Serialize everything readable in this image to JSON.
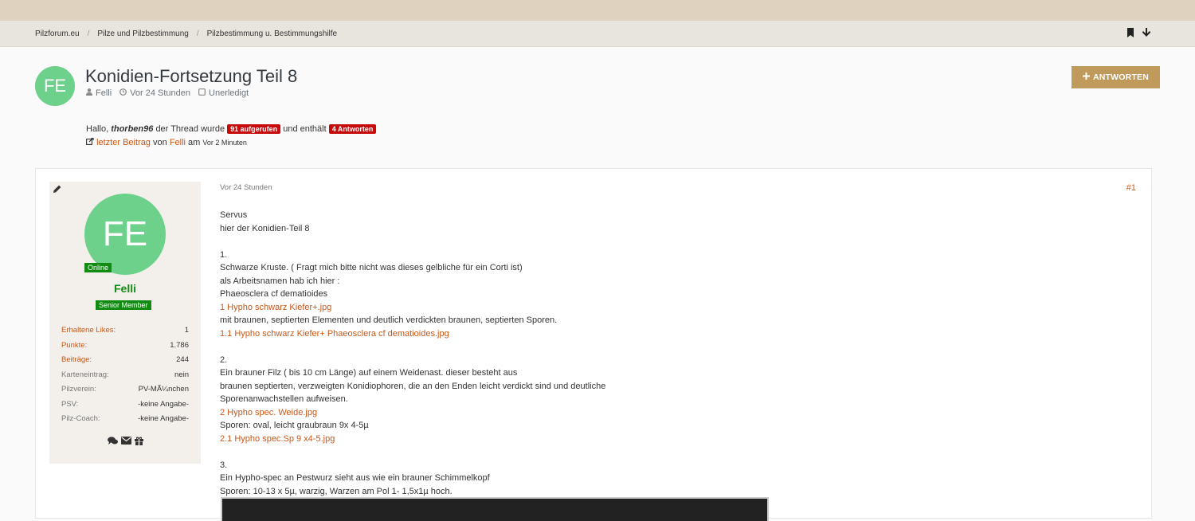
{
  "breadcrumb": [
    {
      "label": "Pilzforum.eu"
    },
    {
      "label": "Pilze und Pilzbestimmung"
    },
    {
      "label": "Pilzbestimmung u. Bestimmungshilfe"
    }
  ],
  "breadcrumb_icons": [
    "bookmark-icon",
    "arrow-down-icon"
  ],
  "thread": {
    "avatar_initials": "FE",
    "title": "Konidien-Fortsetzung Teil 8",
    "author": "Felli",
    "time": "Vor 24 Stunden",
    "status": "Unerledigt"
  },
  "reply_button": {
    "label": "ANTWORTEN"
  },
  "info": {
    "greeting": "Hallo,",
    "username": "thorben96",
    "text_mid": "der Thread wurde",
    "views_badge": "91 aufgerufen",
    "text_and": "und enthält",
    "replies_badge": "4 Antworten",
    "last_post_label": "letzter Beitrag",
    "by_text": "von",
    "last_author": "Felli",
    "at_text": "am",
    "last_time": "Vor 2 Minuten"
  },
  "sidebar": {
    "avatar_initials": "FE",
    "online_label": "Online",
    "username": "Felli",
    "rank": "Senior Member",
    "stats": [
      {
        "label": "Erhaltene Likes:",
        "value": "1",
        "link": true
      },
      {
        "label": "Punkte:",
        "value": "1.786",
        "link": true
      },
      {
        "label": "Beiträge:",
        "value": "244",
        "link": true
      },
      {
        "label": "Karteneintrag:",
        "value": "nein",
        "link": false
      },
      {
        "label": "Pilzverein:",
        "value": "PV-MÃ¼nchen",
        "link": false
      },
      {
        "label": "PSV:",
        "value": "-keine Angabe-",
        "link": false
      },
      {
        "label": "Pilz-Coach:",
        "value": "-keine Angabe-",
        "link": false
      }
    ]
  },
  "post": {
    "time": "Vor 24 Stunden",
    "number": "#1",
    "lines": [
      {
        "text": "Servus"
      },
      {
        "text": "hier der Konidien-Teil 8"
      },
      {
        "text": ""
      },
      {
        "text": "1."
      },
      {
        "text": "Schwarze Kruste. ( Fragt mich bitte nicht was dieses gelbliche für ein Corti ist)"
      },
      {
        "text": "als Arbeitsnamen hab ich hier :"
      },
      {
        "text": "Phaeosclera cf dematioides"
      },
      {
        "text": "1 Hypho schwarz Kiefer+.jpg",
        "link": true
      },
      {
        "text": "mit braunen, septierten Elementen und deutlich verdickten braunen, septierten Sporen."
      },
      {
        "text": "1.1 Hypho schwarz Kiefer+ Phaeosclera cf dematioides.jpg",
        "link": true
      },
      {
        "text": ""
      },
      {
        "text": "2."
      },
      {
        "text": "Ein brauner Filz ( bis 10 cm Länge) auf einem Weidenast. dieser besteht aus"
      },
      {
        "text": "braunen septierten, verzweigten Konidiophoren, die an den Enden leicht verdickt sind und deutliche"
      },
      {
        "text": "Sporenanwachstellen aufweisen."
      },
      {
        "text": "2 Hypho spec. Weide.jpg",
        "link": true
      },
      {
        "text": "Sporen: oval, leicht graubraun 9x 4-5µ"
      },
      {
        "text": "2.1 Hypho spec.Sp 9 x4-5.jpg",
        "link": true
      },
      {
        "text": ""
      },
      {
        "text": "3."
      },
      {
        "text": "Ein Hypho-spec an Pestwurz sieht aus wie ein brauner Schimmelkopf"
      },
      {
        "text": "Sporen: 10-13 x 5µ, warzig, Warzen am Pol 1- 1,5x1µ hoch."
      }
    ]
  },
  "colors": {
    "accent": "#c95817",
    "button": "#c09a5a",
    "online_green": "#128b12",
    "badge_red": "#c70a0a",
    "avatar": "#6dd08b"
  }
}
